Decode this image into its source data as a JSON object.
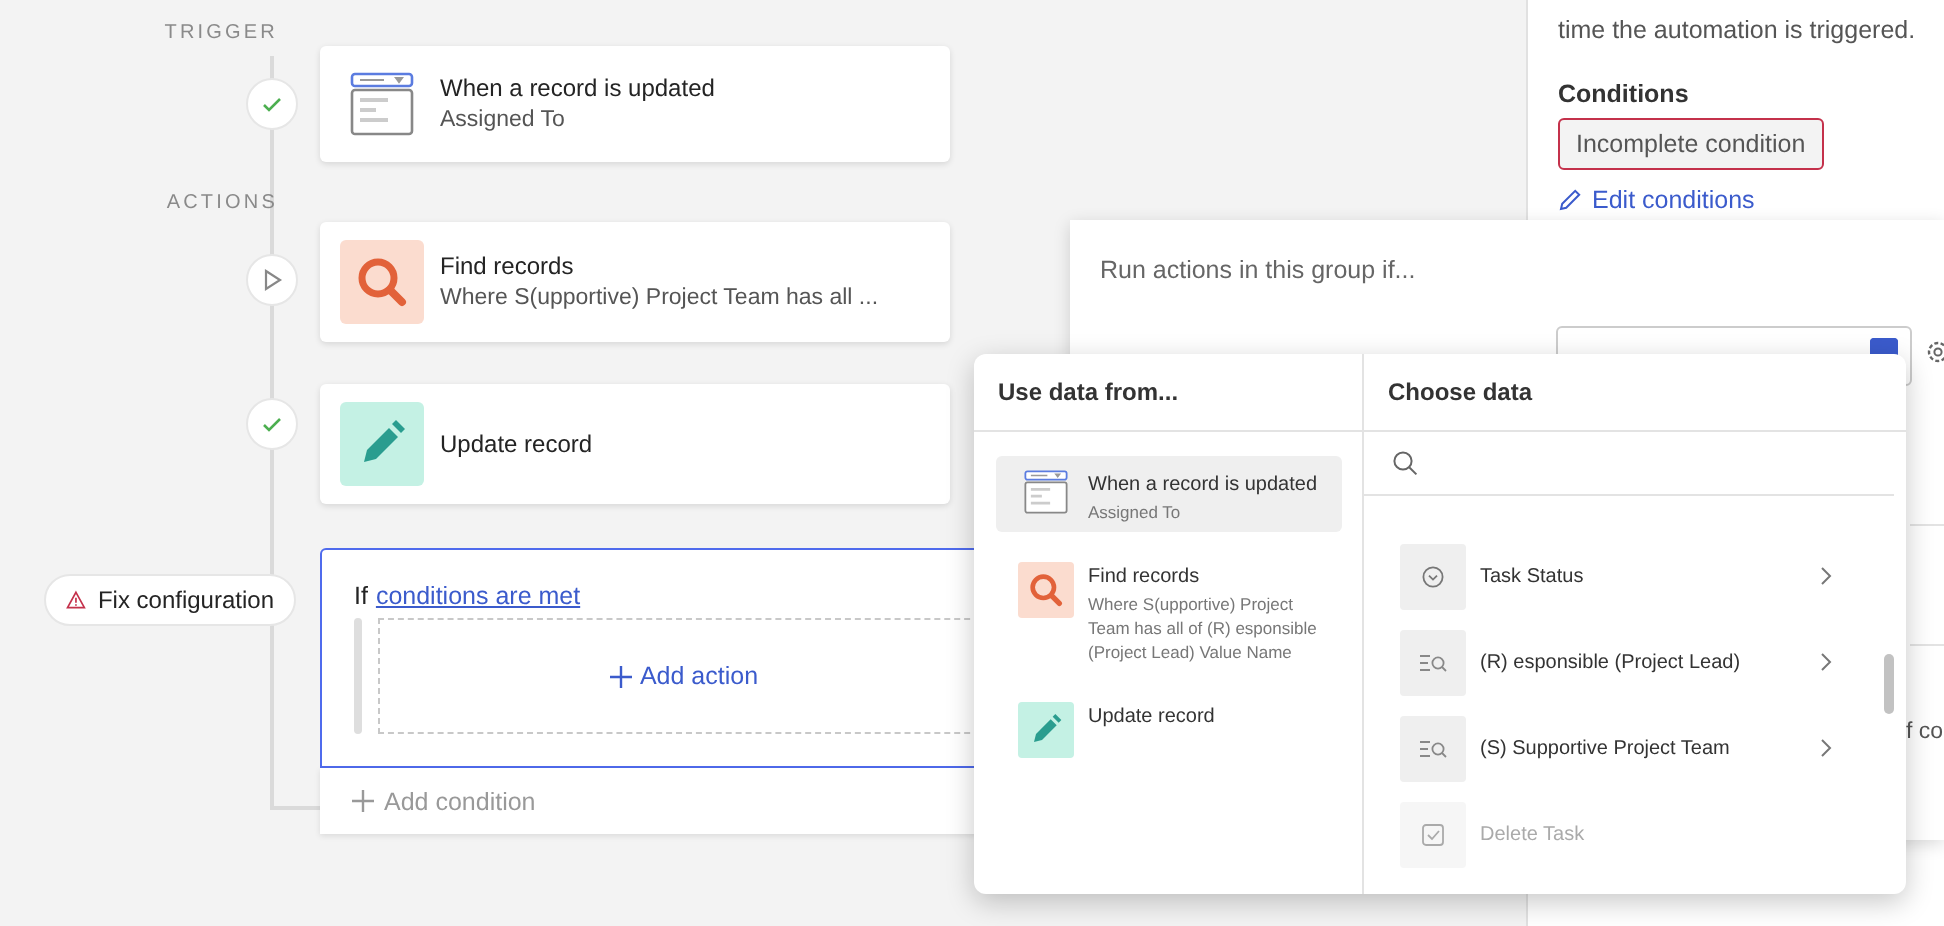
{
  "timeline": {
    "trigger_label": "TRIGGER",
    "actions_label": "ACTIONS",
    "steps": [
      {
        "kind": "trigger",
        "completed": true,
        "title": "When a record is updated",
        "subtitle": "Assigned To"
      },
      {
        "kind": "find",
        "completed": false,
        "title": "Find records",
        "subtitle": "Where S(upportive) Project Team has all ..."
      },
      {
        "kind": "update",
        "completed": true,
        "title": "Update record"
      }
    ],
    "condition_group": {
      "selected": true,
      "warning": "Fix configuration",
      "prefix": "If",
      "link": "conditions are met",
      "add_action": "Add action",
      "add_condition": "Add condition"
    }
  },
  "side_panel": {
    "description": "time the automation is triggered.",
    "conditions_label": "Conditions",
    "condition_badge": "Incomplete condition",
    "edit_link": "Edit conditions"
  },
  "condition_editor": {
    "prompt": "Run actions in this group if...",
    "cut_text": "f co"
  },
  "data_picker": {
    "sources_title": "Use data from...",
    "fields_title": "Choose data",
    "sources": [
      {
        "kind": "trigger",
        "title": "When a record is updated",
        "subtitle": "Assigned To",
        "selected": true
      },
      {
        "kind": "find",
        "title": "Find records",
        "subtitle": "Where S(upportive) Project Team has all of (R) esponsible (Project Lead) Value Name",
        "selected": false
      },
      {
        "kind": "update",
        "title": "Update record",
        "selected": false
      }
    ],
    "fields": [
      {
        "kind": "select",
        "label": "Task Status",
        "disabled": false
      },
      {
        "kind": "lookup",
        "label": "(R) esponsible (Project Lead)",
        "disabled": false
      },
      {
        "kind": "lookup",
        "label": "(S) Supportive Project Team",
        "disabled": false
      },
      {
        "kind": "checkbox",
        "label": "Delete Task",
        "disabled": true
      }
    ]
  }
}
